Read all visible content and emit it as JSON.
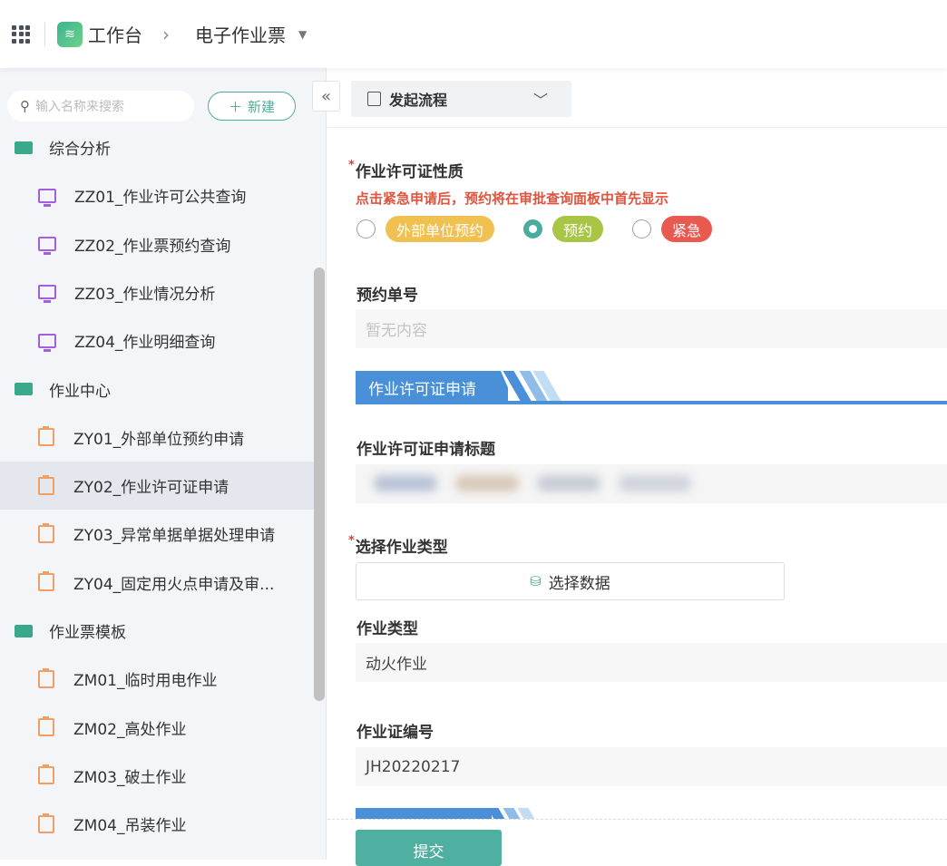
{
  "header": {
    "app_name": "工作台",
    "current": "电子作业票"
  },
  "sidebar": {
    "search_placeholder": "输入名称来搜索",
    "new_label": "新建",
    "groups": [
      {
        "label": "综合分析",
        "items": [
          "ZZ01_作业许可公共查询",
          "ZZ02_作业票预约查询",
          "ZZ03_作业情况分析",
          "ZZ04_作业明细查询"
        ]
      },
      {
        "label": "作业中心",
        "items": [
          "ZY01_外部单位预约申请",
          "ZY02_作业许可证申请",
          "ZY03_异常单据单据处理申请",
          "ZY04_固定用火点申请及审..."
        ]
      },
      {
        "label": "作业票模板",
        "items": [
          "ZM01_临时用电作业",
          "ZM02_高处作业",
          "ZM03_破土作业",
          "ZM04_吊装作业"
        ]
      }
    ],
    "active_item": "ZY02_作业许可证申请"
  },
  "main": {
    "flow_button": "发起流程",
    "nature_label": "作业许可证性质",
    "nature_hint": "点击紧急申请后，预约将在审批查询面板中首先显示",
    "nature_options": [
      {
        "label": "外部单位预约",
        "color": "#f0c050",
        "selected": false
      },
      {
        "label": "预约",
        "color": "#a8c545",
        "selected": true
      },
      {
        "label": "紧急",
        "color": "#e85a50",
        "selected": false
      }
    ],
    "reservation_no_label": "预约单号",
    "reservation_no_value": "暂无内容",
    "section_title": "作业许可证申请",
    "title_label": "作业许可证申请标题",
    "select_type_label": "选择作业类型",
    "select_data_button": "选择数据",
    "work_type_label": "作业类型",
    "work_type_value": "动火作业",
    "cert_no_label": "作业证编号",
    "cert_no_value": "JH20220217",
    "submit": "提交"
  }
}
